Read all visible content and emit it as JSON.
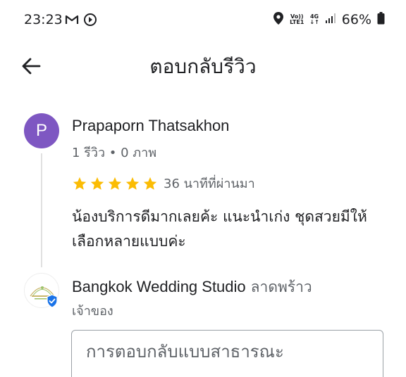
{
  "status_bar": {
    "time": "23:23",
    "battery_percent": "66%",
    "network": "4G",
    "volte": "Vo))",
    "lte": "LTE1"
  },
  "app_bar": {
    "title": "ตอบกลับรีวิว"
  },
  "review": {
    "avatar_letter": "P",
    "avatar_color": "#7e57c2",
    "reviewer_name": "Prapaporn Thatsakhon",
    "reviewer_meta": "1 รีวิว • 0 ภาพ",
    "rating": 5,
    "time_ago": "36 นาทีที่ผ่านมา",
    "text": "น้องบริการดีมากเลยค้ะ แนะนำเก่ง ชุดสวยมีให้เลือกหลายแบบค่ะ"
  },
  "owner": {
    "name": "Bangkok Wedding Studio",
    "location": "ลาดพร้าว",
    "role": "เจ้าของ"
  },
  "reply": {
    "placeholder": "การตอบกลับแบบสาธารณะ",
    "value": ""
  },
  "colors": {
    "star": "#fbbc04",
    "verified": "#1a73e8"
  }
}
